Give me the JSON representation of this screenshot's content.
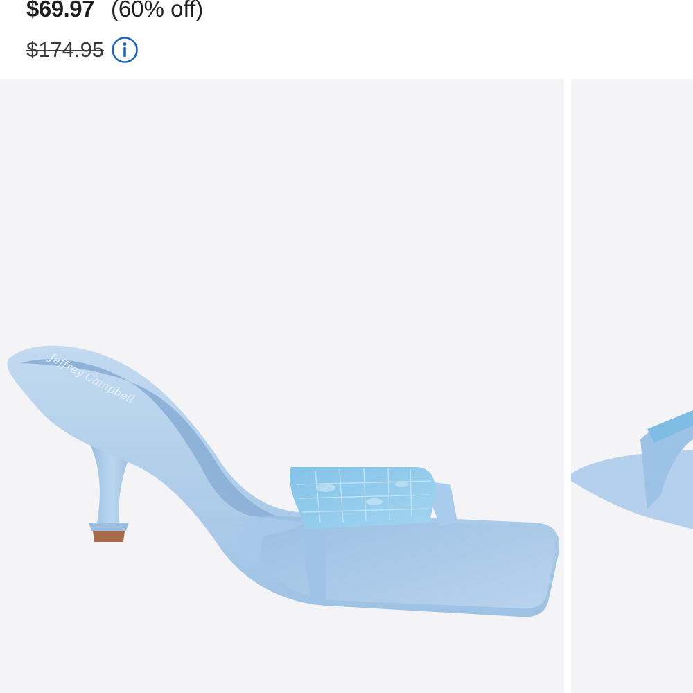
{
  "product": {
    "sale_price": "$69.97",
    "discount": "(60% off)",
    "original_price": "$174.95",
    "info_icon": "info-circle-icon"
  },
  "gallery": {
    "main_image_alt": "Light blue satin square-toe mule sandal with resin tile strap",
    "insole_brand": "Jeffrey Campbell",
    "next_image_alt": "Light blue sandal alternate view"
  },
  "colors": {
    "accent": "#1e63c4",
    "background": "#f4f4f6",
    "satin": "#a9c9e8"
  }
}
